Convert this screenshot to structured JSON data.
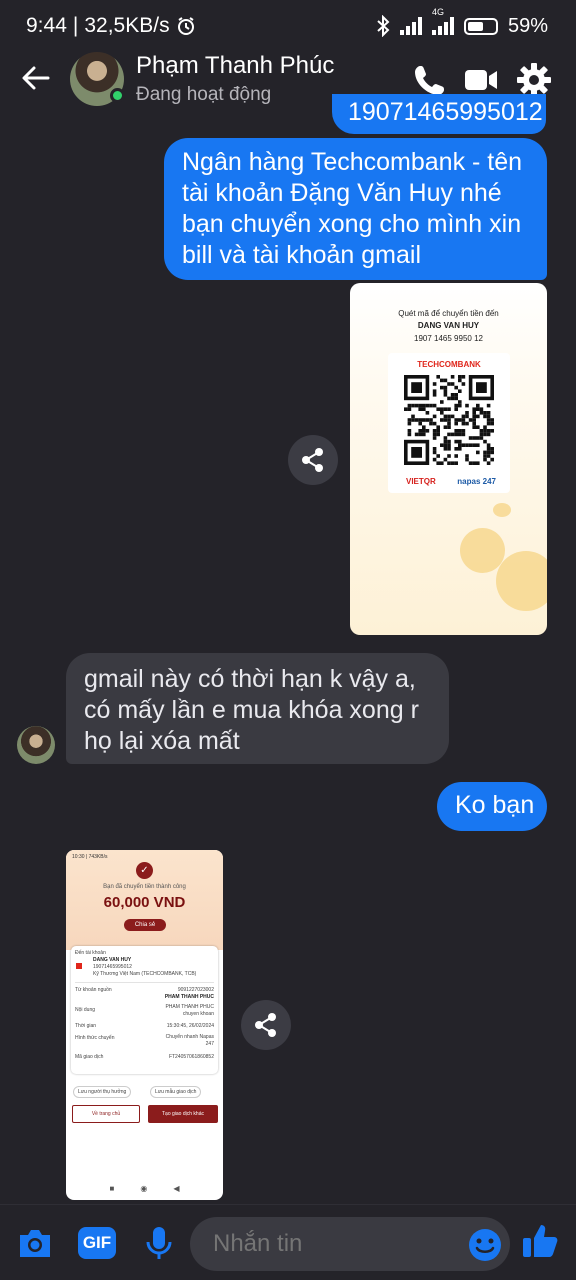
{
  "status_bar": {
    "time": "9:44",
    "separator": "|",
    "net_speed": "32,5KB/s",
    "network_type": "4G",
    "battery": "59%",
    "battery_level": 0.59
  },
  "header": {
    "contact_name": "Phạm Thanh Phúc",
    "contact_status": "Đang hoạt động",
    "icons": [
      "back-arrow-icon",
      "phone-icon",
      "video-camera-icon",
      "gear-icon"
    ]
  },
  "messages": {
    "cut_off_top": "19071465995012",
    "bank_info": {
      "lines": [
        "Ngân hàng Techcombank - tên",
        "tài khoản Đặng Văn Huy nhé",
        "bạn chuyển xong cho mình xin",
        "bill và tài khoản gmail"
      ]
    },
    "qr_image": {
      "caption": "Quét mã để chuyển tiền đến",
      "name": "DANG VAN HUY",
      "account": "1907 1465 9950 12",
      "bank": "TECHCOMBANK",
      "vietqr": "VIETQR",
      "napas": "napas 247"
    },
    "gmail_question": {
      "lines": [
        "gmail này có thời hạn k vậy a,",
        "có mấy lần e mua khóa xong r",
        "họ lại xóa mất"
      ]
    },
    "reply": "Ko bạn",
    "receipt_image": {
      "status_time": "10:30 | 743KB/s",
      "success": "Bạn đã chuyển tiền thành công",
      "amount": "60,000 VND",
      "share": "Chia sẻ",
      "to_label": "Đến tài khoản",
      "to_name": "DANG VAN HUY",
      "to_account": "19071465995012",
      "to_bank": "Kỹ Thương Việt Nam (TECHCOMBANK, TCB)",
      "from_label": "Từ khoản nguồn",
      "from_account": "9091227023002",
      "from_name": "PHAM THANH PHUC",
      "content_label": "Nội dung",
      "content_1": "PHAM THANH PHUC",
      "content_2": "chuyen khoan",
      "time_label": "Thời gian",
      "time_value": "15:30:45, 26/02/2024",
      "method_label": "Hình thức chuyển",
      "method_value_1": "Chuyển nhanh Napas",
      "method_value_2": "247",
      "code_label": "Mã giao dịch",
      "code_value": "FT24057061860852",
      "save_recipient": "Lưu người thụ hưởng",
      "save_template": "Lưu mẫu giao dịch",
      "home_button": "Về trang chủ",
      "new_button": "Tạo giao dịch khác"
    }
  },
  "composer": {
    "placeholder": "Nhắn tin",
    "icons": [
      "camera-icon",
      "gif-icon",
      "microphone-icon",
      "emoji-icon",
      "thumbs-up-icon"
    ],
    "gif_label": "GIF"
  },
  "colors": {
    "background": "#242329",
    "outgoing_bubble": "#1877f2",
    "incoming_bubble": "#3a3a41",
    "accent": "#1877f2",
    "online": "#31d16b"
  }
}
